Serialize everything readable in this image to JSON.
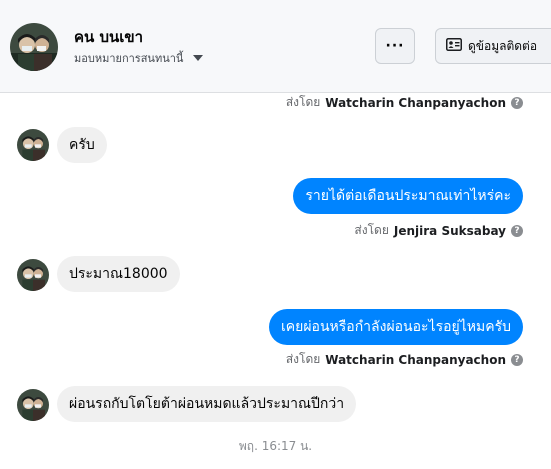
{
  "header": {
    "name": "คน บนเขา",
    "subtitle": "มอบหมายการสนทนานี้",
    "more_label": "···",
    "info_label": "ดูข้อมูลติดต่อ"
  },
  "messages": [
    {
      "type": "sent_by",
      "prefix": "ส่งโดย",
      "agent": "Watcharin Chanpanyachon"
    },
    {
      "type": "incoming",
      "text": "ครับ"
    },
    {
      "type": "outgoing",
      "text": "รายได้ต่อเดือนประมาณเท่าไหร่คะ"
    },
    {
      "type": "sent_by",
      "prefix": "ส่งโดย",
      "agent": "Jenjira Suksabay"
    },
    {
      "type": "incoming",
      "text": "ประมาณ18000"
    },
    {
      "type": "outgoing",
      "text": "เคยผ่อนหรือกำลังผ่อนอะไรอยู่ไหมครับ"
    },
    {
      "type": "sent_by",
      "prefix": "ส่งโดย",
      "agent": "Watcharin Chanpanyachon"
    },
    {
      "type": "incoming",
      "text": "ผ่อนรถกับโตโยต้าผ่อนหมดแล้วประมาณปีกว่า"
    }
  ],
  "timestamp": "พฤ. 16:17 น.",
  "colors": {
    "outgoing_bubble": "#0084ff",
    "incoming_bubble": "#f0f0f0",
    "header_bg": "#f7f8fa"
  }
}
